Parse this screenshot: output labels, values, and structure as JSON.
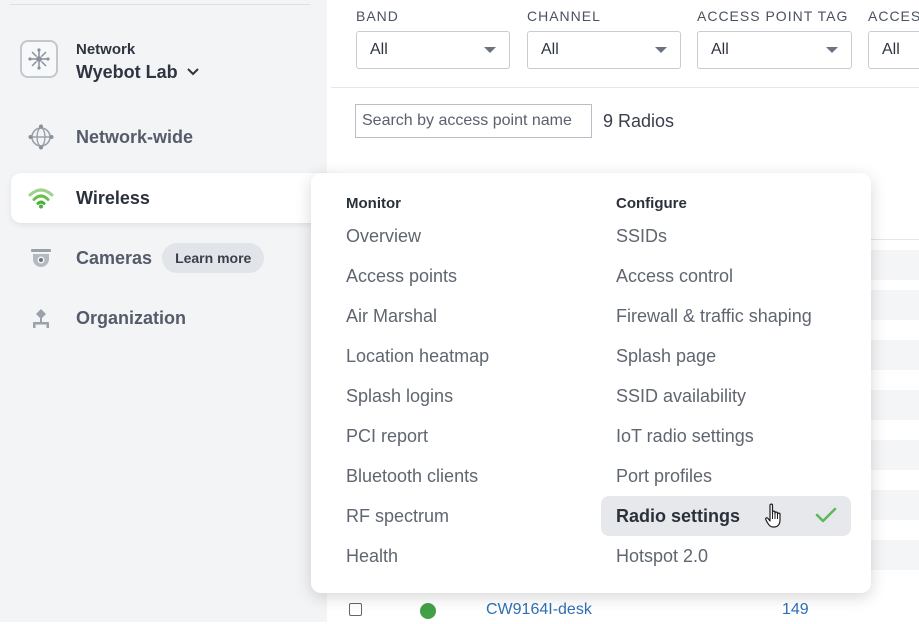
{
  "sidebar": {
    "network_label": "Network",
    "network_name": "Wyebot Lab",
    "items": [
      {
        "label": "Network-wide",
        "icon": "globe-network-icon"
      },
      {
        "label": "Wireless",
        "icon": "wifi-icon",
        "active": true
      },
      {
        "label": "Cameras",
        "icon": "camera-icon",
        "badge": "Learn more"
      },
      {
        "label": "Organization",
        "icon": "organization-icon"
      }
    ]
  },
  "filters": [
    {
      "label": "BAND",
      "value": "All"
    },
    {
      "label": "CHANNEL",
      "value": "All"
    },
    {
      "label": "ACCESS POINT TAG",
      "value": "All"
    },
    {
      "label": "ACCESS",
      "value": "All"
    }
  ],
  "search": {
    "placeholder": "Search by access point name"
  },
  "radio_count": "9 Radios",
  "table_row": {
    "ap_name": "CW9164I-desk",
    "channel": "149",
    "status_color": "#43a047"
  },
  "menu": {
    "monitor": {
      "heading": "Monitor",
      "items": [
        "Overview",
        "Access points",
        "Air Marshal",
        "Location heatmap",
        "Splash logins",
        "PCI report",
        "Bluetooth clients",
        "RF spectrum",
        "Health"
      ]
    },
    "configure": {
      "heading": "Configure",
      "items": [
        "SSIDs",
        "Access control",
        "Firewall & traffic shaping",
        "Splash page",
        "SSID availability",
        "IoT radio settings",
        "Port profiles",
        "Radio settings",
        "Hotspot 2.0"
      ],
      "selected": "Radio settings"
    }
  },
  "colors": {
    "accent_green": "#5cb85c",
    "link_blue": "#2f6fb5"
  }
}
